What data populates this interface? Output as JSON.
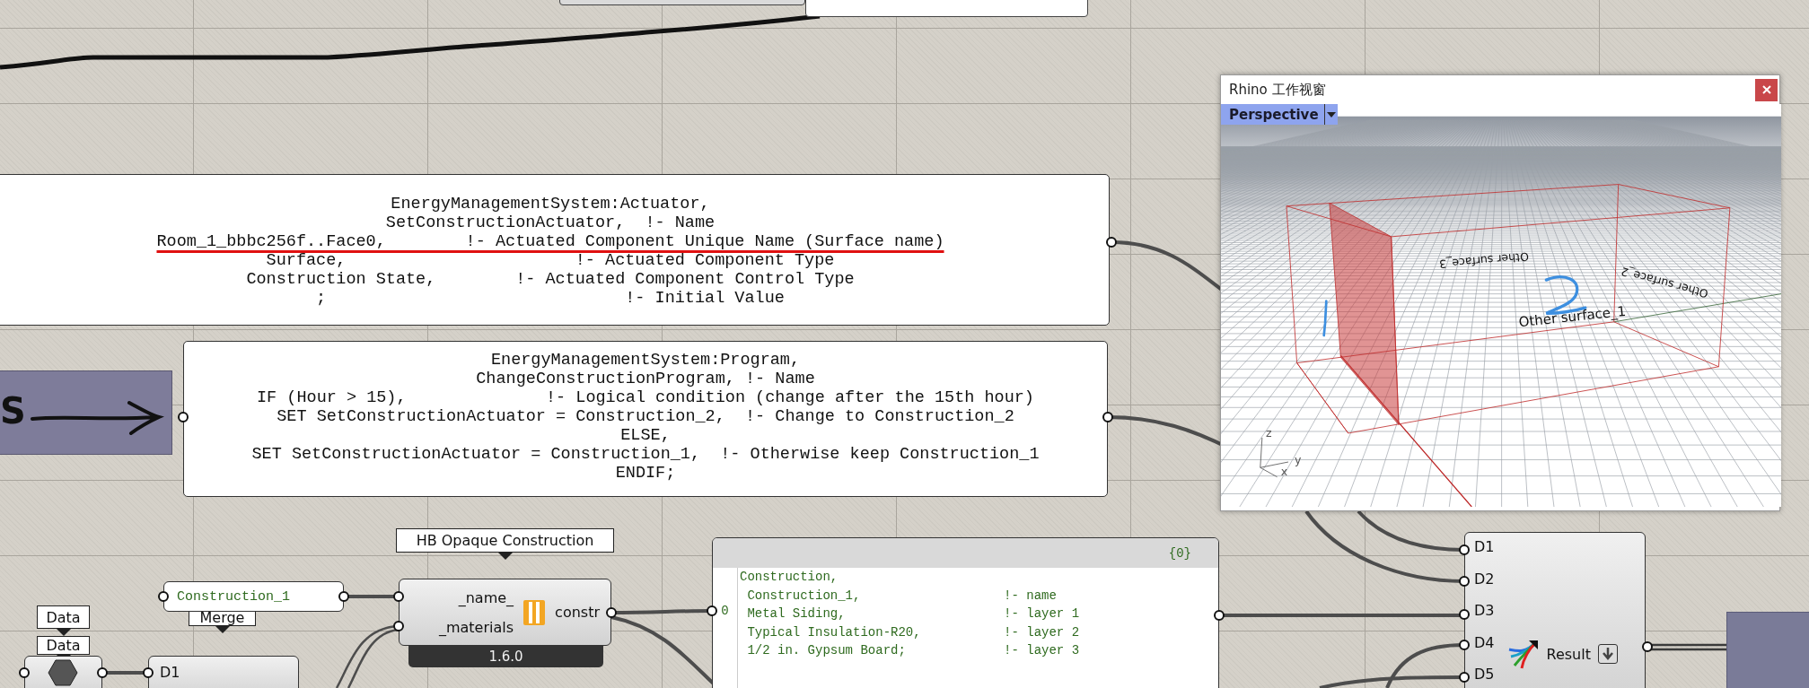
{
  "actuator_panel": {
    "lines": [
      {
        "text": "EnergyManagementSystem:Actuator,",
        "underlined": false
      },
      {
        "text": "SetConstructionActuator,  !- Name",
        "underlined": false
      },
      {
        "text": "Room_1_bbbc256f..Face0,        !- Actuated Component Unique Name (Surface name)",
        "underlined": true
      },
      {
        "text": "Surface,                       !- Actuated Component Type",
        "underlined": false
      },
      {
        "text": "Construction State,        !- Actuated Component Control Type",
        "underlined": false
      },
      {
        "text": ";                              !- Initial Value",
        "underlined": false
      }
    ]
  },
  "program_panel": {
    "lines": [
      "EnergyManagementSystem:Program,",
      "ChangeConstructionProgram, !- Name",
      "IF (Hour > 15),              !- Logical condition (change after the 15th hour)",
      "SET SetConstructionActuator = Construction_2,  !- Change to Construction_2",
      "ELSE,",
      "SET SetConstructionActuator = Construction_1,  !- Otherwise keep Construction_1",
      "ENDIF;"
    ]
  },
  "arrow_block": {
    "text": "S"
  },
  "rhino_viewport": {
    "title": "Rhino 工作视窗",
    "view_tab": "Perspective",
    "surface_labels": [
      "Other surface_3",
      "Other surface_2",
      "Other surface_1"
    ],
    "axis_labels": [
      "z",
      "y",
      "x"
    ]
  },
  "hb_opaque_construction": {
    "tooltip": "HB Opaque Construction",
    "inputs": [
      "_name_",
      "_materials"
    ],
    "output": "constr",
    "version": "1.6.0"
  },
  "name_panel": {
    "value": "Construction_1"
  },
  "merge": {
    "label": "Merge",
    "inputs": [
      "D1"
    ]
  },
  "data_param": {
    "labels": [
      "Data",
      "Data"
    ]
  },
  "construction_panel": {
    "path": "{0}",
    "index": "0",
    "lines": [
      "Construction,",
      " Construction_1,                   !- name",
      " Metal Siding,                     !- layer 1",
      " Typical Insulation-R20,           !- layer 2",
      " 1/2 in. Gypsum Board;             !- layer 3"
    ]
  },
  "result_component": {
    "inputs": [
      "D1",
      "D2",
      "D3",
      "D4",
      "D5"
    ],
    "output": "Result"
  }
}
